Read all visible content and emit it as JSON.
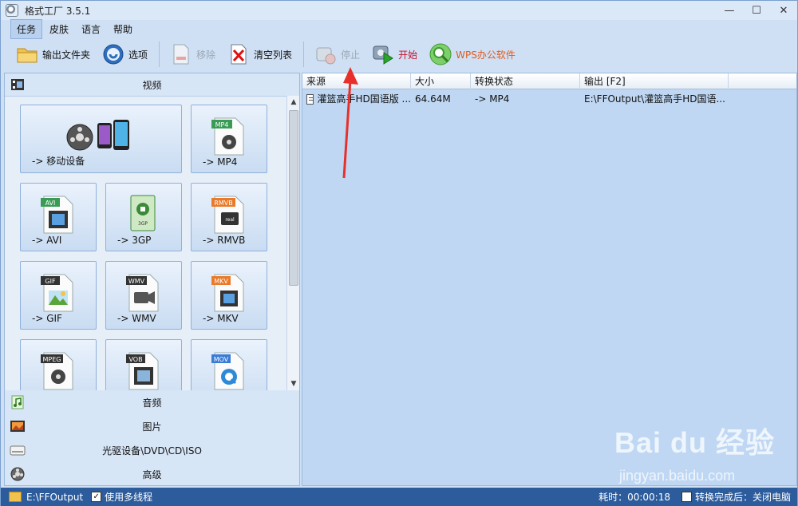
{
  "window": {
    "title": "格式工厂 3.5.1",
    "controls": [
      "—",
      "☐",
      "✕"
    ]
  },
  "menu": {
    "items": [
      "任务",
      "皮肤",
      "语言",
      "帮助"
    ]
  },
  "toolbar": {
    "output_folder": "输出文件夹",
    "options": "选项",
    "remove": "移除",
    "clear_list": "清空列表",
    "stop": "停止",
    "start": "开始",
    "wps": "WPS办公软件"
  },
  "categories": {
    "video": "视频",
    "audio": "音频",
    "picture": "图片",
    "disc": "光驱设备\\DVD\\CD\\ISO",
    "advanced": "高级"
  },
  "tiles": [
    {
      "label": "-> 移动设备",
      "badge": ""
    },
    {
      "label": "-> MP4",
      "badge": "MP4"
    },
    {
      "label": "-> AVI",
      "badge": "AVI"
    },
    {
      "label": "-> 3GP",
      "badge": "3GP"
    },
    {
      "label": "-> RMVB",
      "badge": "RMVB"
    },
    {
      "label": "-> GIF",
      "badge": "GIF"
    },
    {
      "label": "-> WMV",
      "badge": "WMV"
    },
    {
      "label": "-> MKV",
      "badge": "MKV"
    },
    {
      "label": "",
      "badge": "MPEG"
    },
    {
      "label": "",
      "badge": "VOB"
    },
    {
      "label": "",
      "badge": "MOV"
    }
  ],
  "list": {
    "columns": [
      "来源",
      "大小",
      "转换状态",
      "输出 [F2]"
    ],
    "rows": [
      {
        "source": "灌篮高手HD国语版 ...",
        "size": "64.64M",
        "status": "-> MP4",
        "output": "E:\\FFOutput\\灌篮高手HD国语..."
      }
    ]
  },
  "status": {
    "output_path": "E:\\FFOutput",
    "multithread": "使用多线程",
    "elapsed": "耗时：00:00:18",
    "after_done": "转换完成后：关闭电脑"
  },
  "watermark": {
    "brand": "Bai du 经验",
    "url": "jingyan.baidu.com"
  },
  "colors": {
    "accent": "#2d5c9c",
    "start": "#c8102e",
    "wps": "#e25a1c",
    "annotation": "#e8302a"
  }
}
